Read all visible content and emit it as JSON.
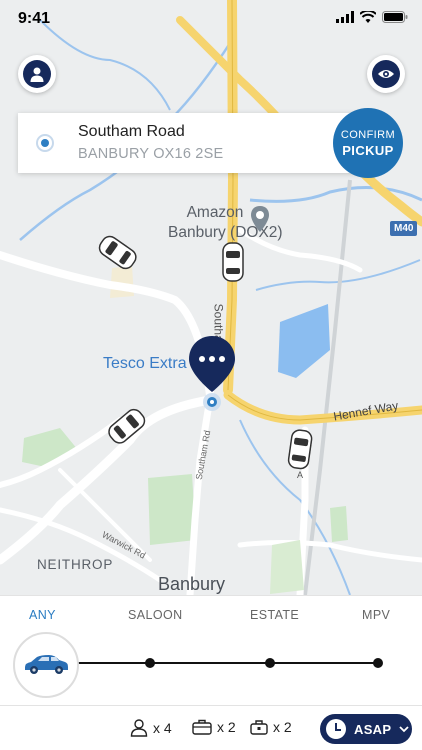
{
  "status_bar": {
    "time": "9:41"
  },
  "address": {
    "line1": "Southam Road",
    "line2": "BANBURY OX16 2SE"
  },
  "confirm_button": {
    "line1": "CONFIRM",
    "line2": "PICKUP"
  },
  "map_labels": {
    "amazon": "Amazon\nBanbury (DOX2)",
    "tesco": "Tesco Extra",
    "southam_rd_vertical": "Southam Rd",
    "southam_rd_small": "Southam Rd",
    "hennef_way": "Hennef Way",
    "warwick_rd": "Warwick Rd",
    "neithrop": "NEITHROP",
    "banbury": "Banbury",
    "m40": "M40",
    "road_a": "A"
  },
  "vehicle_tabs": [
    {
      "label": "ANY",
      "active": true
    },
    {
      "label": "SALOON",
      "active": false
    },
    {
      "label": "ESTATE",
      "active": false
    },
    {
      "label": "MPV",
      "active": false
    }
  ],
  "slider": {
    "selected_index": 0
  },
  "footer": {
    "passengers": "x 4",
    "luggage": "x 2",
    "hand_luggage": "x 2",
    "time_button": "ASAP"
  },
  "colors": {
    "brand_navy": "#16295c",
    "confirm_blue": "#1f72b4",
    "active_tab": "#2a7cc2",
    "road_yellow": "#f6d46e"
  },
  "icons": [
    "profile-icon",
    "eye-icon",
    "location-dot-icon",
    "pickup-pin-icon",
    "car-icon",
    "passenger-icon",
    "suitcase-icon",
    "briefcase-icon",
    "clock-icon",
    "chevron-down-icon"
  ]
}
